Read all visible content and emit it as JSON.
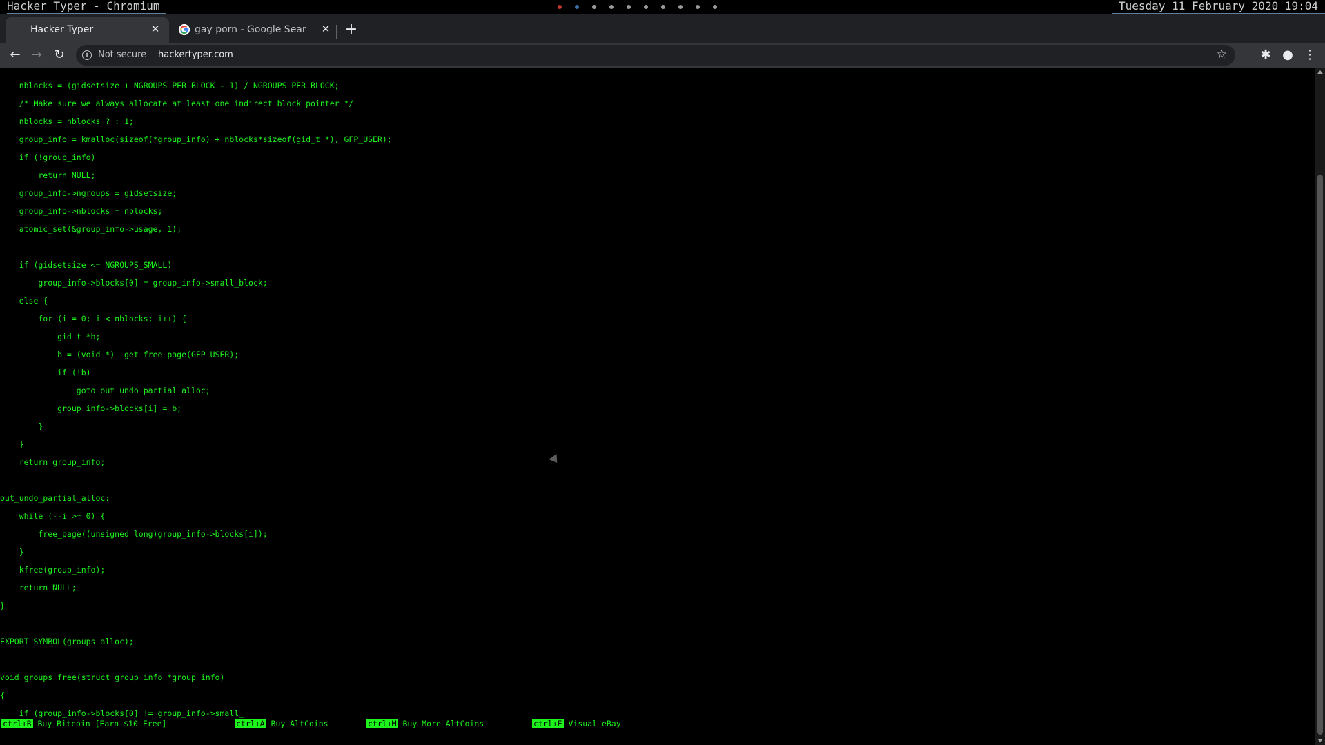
{
  "system_bar": {
    "window_title": "Hacker Typer - Chromium",
    "workspaces": [
      {
        "color": "#c0392b"
      },
      {
        "color": "#3b6ea5"
      },
      {
        "color": "#9a9a9a"
      },
      {
        "color": "#9a9a9a"
      },
      {
        "color": "#9a9a9a"
      },
      {
        "color": "#9a9a9a"
      },
      {
        "color": "#9a9a9a"
      },
      {
        "color": "#9a9a9a"
      },
      {
        "color": "#9a9a9a"
      },
      {
        "color": "#9a9a9a"
      }
    ],
    "clock": "Tuesday 11 February 2020 19:04"
  },
  "browser": {
    "tabs": [
      {
        "title": "Hacker Typer",
        "close": "✕",
        "active": true
      },
      {
        "title": "gay porn - Google Sear",
        "close": "✕",
        "active": false,
        "favicon": "google-icon"
      }
    ],
    "new_tab": "+",
    "toolbar": {
      "back": "←",
      "forward": "→",
      "reload": "↻",
      "security_label": "Not secure",
      "url": "hackertyper.com",
      "bookmark": "☆",
      "extensions": "✱",
      "profile": "●",
      "menu": "⋮"
    }
  },
  "page": {
    "text_color": "#1df21d",
    "code_lines": [
      "    nblocks = (gidsetsize + NGROUPS_PER_BLOCK - 1) / NGROUPS_PER_BLOCK;",
      "    /* Make sure we always allocate at least one indirect block pointer */",
      "    nblocks = nblocks ? : 1;",
      "    group_info = kmalloc(sizeof(*group_info) + nblocks*sizeof(gid_t *), GFP_USER);",
      "    if (!group_info)",
      "        return NULL;",
      "    group_info->ngroups = gidsetsize;",
      "    group_info->nblocks = nblocks;",
      "    atomic_set(&group_info->usage, 1);",
      "",
      "    if (gidsetsize <= NGROUPS_SMALL)",
      "        group_info->blocks[0] = group_info->small_block;",
      "    else {",
      "        for (i = 0; i < nblocks; i++) {",
      "            gid_t *b;",
      "            b = (void *)__get_free_page(GFP_USER);",
      "            if (!b)",
      "                goto out_undo_partial_alloc;",
      "            group_info->blocks[i] = b;",
      "        }",
      "    }",
      "    return group_info;",
      "",
      "out_undo_partial_alloc:",
      "    while (--i >= 0) {",
      "        free_page((unsigned long)group_info->blocks[i]);",
      "    }",
      "    kfree(group_info);",
      "    return NULL;",
      "}",
      "",
      "EXPORT_SYMBOL(groups_alloc);",
      "",
      "void groups_free(struct group_info *group_info)",
      "{",
      "    if (group_info->blocks[0] != group_info->small_"
    ],
    "footer_links": [
      {
        "key": "ctrl+B",
        "label": "Buy Bitcoin [Earn $10 Free]"
      },
      {
        "key": "ctrl+A",
        "label": "Buy AltCoins"
      },
      {
        "key": "ctrl+M",
        "label": "Buy More AltCoins"
      },
      {
        "key": "ctrl+E",
        "label": "Visual eBay"
      }
    ]
  }
}
